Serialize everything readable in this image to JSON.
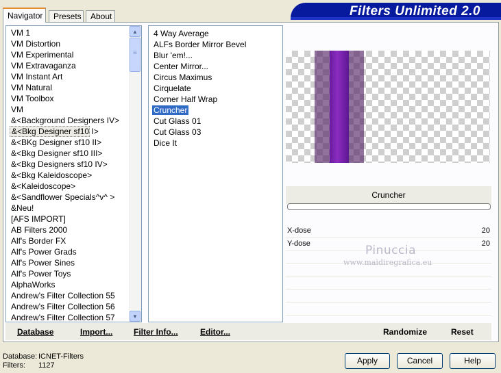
{
  "tabs": {
    "navigator": "Navigator",
    "presets": "Presets",
    "about": "About"
  },
  "title": "Filters Unlimited 2.0",
  "categories": [
    "VM 1",
    "VM Distortion",
    "VM Experimental",
    "VM Extravaganza",
    "VM Instant Art",
    "VM Natural",
    "VM Toolbox",
    "VM",
    "&<Background Designers IV>",
    "&<Bkg Designer sf10 I>",
    "&<BKg Designer sf10 II>",
    "&<Bkg Designer sf10 III>",
    "&<Bkg Designers sf10 IV>",
    "&<Bkg Kaleidoscope>",
    "&<Kaleidoscope>",
    "&<Sandflower Specials^v^ >",
    "&Neu!",
    "[AFS IMPORT]",
    "AB Filters 2000",
    "Alf's Border FX",
    "Alf's Power Grads",
    "Alf's Power Sines",
    "Alf's Power Toys",
    "AlphaWorks",
    "Andrew's Filter Collection 55",
    "Andrew's Filter Collection 56",
    "Andrew's Filter Collection 57"
  ],
  "filters": [
    "4 Way Average",
    "ALFs Border Mirror Bevel",
    "Blur 'em!...",
    "Center Mirror...",
    "Circus Maximus",
    "Cirquelate",
    "Corner Half Wrap",
    "Cruncher",
    "Cut Glass 01",
    "Cut Glass 03",
    "Dice It"
  ],
  "selected_filter": "Cruncher",
  "params": [
    {
      "label": "X-dose",
      "value": "20"
    },
    {
      "label": "Y-dose",
      "value": "20"
    }
  ],
  "watermark": {
    "line1": "Pinuccia",
    "line2": "www.maidiregrafica.eu"
  },
  "bottom_links": {
    "database": "Database",
    "import": "Import...",
    "filter_info": "Filter Info...",
    "editor": "Editor...",
    "randomize": "Randomize",
    "reset": "Reset"
  },
  "info": {
    "database_label": "Database:",
    "database_value": "ICNET-Filters",
    "filters_label": "Filters:",
    "filters_value": "1127"
  },
  "buttons": {
    "apply": "Apply",
    "cancel": "Cancel",
    "help": "Help"
  }
}
